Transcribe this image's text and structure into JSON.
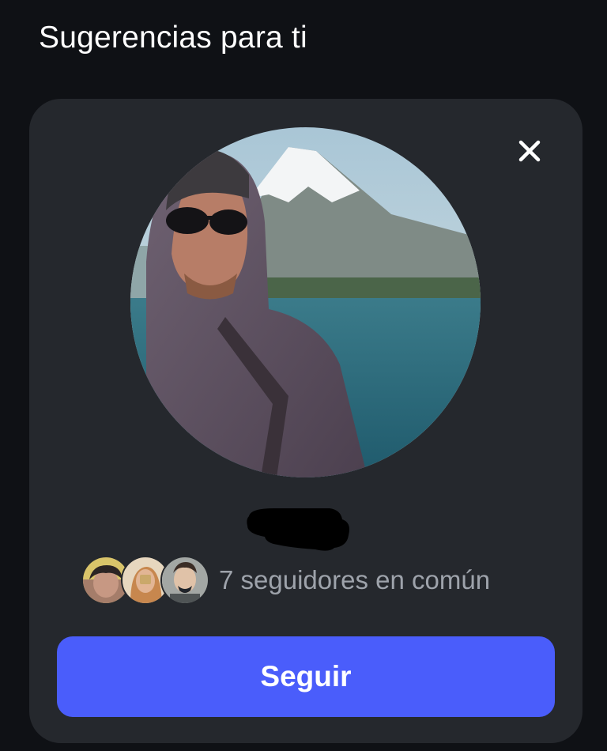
{
  "section": {
    "title": "Sugerencias para ti"
  },
  "card": {
    "close_icon": "close-icon",
    "mutuals": {
      "count": 7,
      "text": "7 seguidores en común"
    },
    "follow_button": {
      "label": "Seguir"
    }
  },
  "colors": {
    "background": "#0f1115",
    "card": "#25282d",
    "accent": "#4a5dfb",
    "text_primary": "#ffffff",
    "text_secondary": "#9ea3ab"
  }
}
